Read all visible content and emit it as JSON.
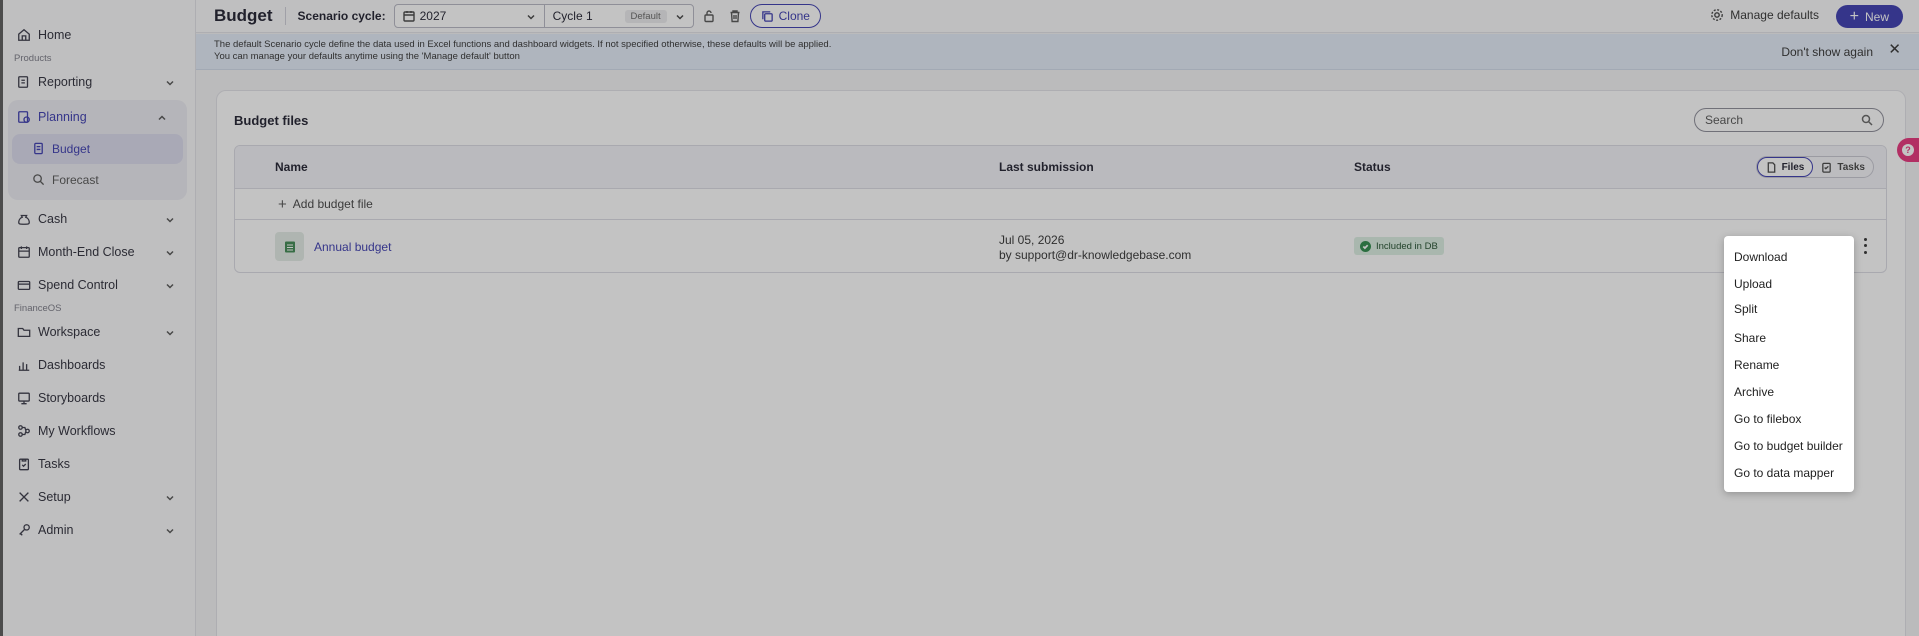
{
  "sidebar": {
    "home": "Home",
    "products_label": "Products",
    "reporting": "Reporting",
    "planning": "Planning",
    "budget": "Budget",
    "forecast": "Forecast",
    "cash": "Cash",
    "month_end_close": "Month-End Close",
    "spend_control": "Spend Control",
    "financeos_label": "FinanceOS",
    "workspace": "Workspace",
    "dashboards": "Dashboards",
    "storyboards": "Storyboards",
    "my_workflows": "My Workflows",
    "tasks": "Tasks",
    "setup": "Setup",
    "admin": "Admin"
  },
  "header": {
    "title": "Budget",
    "scenario_label": "Scenario cycle:",
    "year": "2027",
    "cycle": "Cycle 1",
    "cycle_badge": "Default",
    "clone": "Clone",
    "manage_defaults": "Manage defaults",
    "new": "New"
  },
  "banner": {
    "line1": "The default Scenario cycle define the data used in Excel functions and dashboard widgets. If not specified otherwise, these defaults will be applied.",
    "line2": "You can manage your defaults anytime using the 'Manage default' button",
    "dont_show": "Don't show again",
    "close": "✕"
  },
  "main": {
    "title": "Budget files",
    "search_placeholder": "Search",
    "columns": {
      "name": "Name",
      "last_submission": "Last submission",
      "status": "Status"
    },
    "toggle": {
      "files": "Files",
      "tasks": "Tasks"
    },
    "add_file": "Add budget file",
    "rows": [
      {
        "name": "Annual budget",
        "date": "Jul 05, 2026",
        "by": "by support@dr-knowledgebase.com",
        "status": "Included in DB"
      }
    ]
  },
  "context_menu": {
    "items": [
      "Download",
      "Upload",
      "Split",
      "Share",
      "Rename",
      "Archive",
      "Go to filebox",
      "Go to budget builder",
      "Go to data mapper"
    ]
  },
  "colors": {
    "accent": "#3b3bb0",
    "status_green": "#2d8a4a",
    "help": "#e8337a"
  }
}
